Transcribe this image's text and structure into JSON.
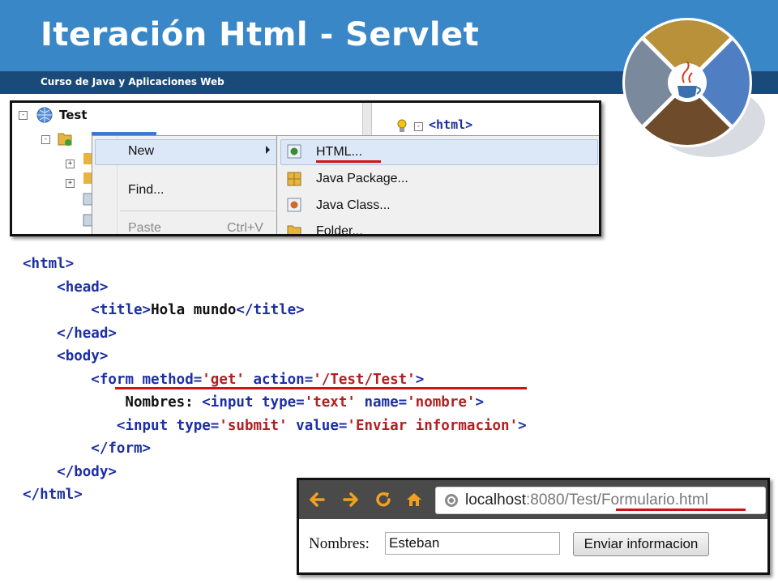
{
  "slide": {
    "title": "Iteración Html - Servlet",
    "subtitle": "Curso de Java y Aplicaciones Web"
  },
  "colors": {
    "header_blue": "#3a87c8",
    "subbar_navy": "#1a4a7a",
    "tag_blue": "#1c2fa3",
    "value_red": "#b02020",
    "underline_red": "#d01414"
  },
  "logo": {
    "icon": "java-cup-icon"
  },
  "ide": {
    "tree_root": "Test",
    "editor_tag": "<html>",
    "context_menu": {
      "items": [
        "New",
        "Find...",
        "Paste"
      ],
      "paste_shortcut": "Ctrl+V"
    },
    "new_submenu": {
      "items": [
        "HTML...",
        "Java Package...",
        "Java Class...",
        "Folder..."
      ]
    }
  },
  "code": {
    "lines": [
      [
        {
          "t": "tag",
          "v": "<html>"
        }
      ],
      [
        {
          "t": "text",
          "v": "    "
        },
        {
          "t": "tag",
          "v": "<head>"
        }
      ],
      [
        {
          "t": "text",
          "v": "        "
        },
        {
          "t": "tag",
          "v": "<title>"
        },
        {
          "t": "text",
          "v": "Hola mundo"
        },
        {
          "t": "tag",
          "v": "</title>"
        }
      ],
      [
        {
          "t": "text",
          "v": "    "
        },
        {
          "t": "tag",
          "v": "</head>"
        }
      ],
      [
        {
          "t": "text",
          "v": "    "
        },
        {
          "t": "tag",
          "v": "<body>"
        }
      ],
      [
        {
          "t": "text",
          "v": "        "
        },
        {
          "t": "tag",
          "v": "<form method="
        },
        {
          "t": "val",
          "v": "'get'"
        },
        {
          "t": "tag",
          "v": " action="
        },
        {
          "t": "val",
          "v": "'/Test/Test'"
        },
        {
          "t": "tag",
          "v": ">"
        }
      ],
      [
        {
          "t": "text",
          "v": "            Nombres: "
        },
        {
          "t": "tag",
          "v": "<input type="
        },
        {
          "t": "val",
          "v": "'text'"
        },
        {
          "t": "tag",
          "v": " name="
        },
        {
          "t": "val",
          "v": "'nombre'"
        },
        {
          "t": "tag",
          "v": ">"
        }
      ],
      [
        {
          "t": "text",
          "v": "           "
        },
        {
          "t": "tag",
          "v": "<input type="
        },
        {
          "t": "val",
          "v": "'submit'"
        },
        {
          "t": "tag",
          "v": " value="
        },
        {
          "t": "val",
          "v": "'Enviar informacion'"
        },
        {
          "t": "tag",
          "v": ">"
        }
      ],
      [
        {
          "t": "text",
          "v": "        "
        },
        {
          "t": "tag",
          "v": "</form>"
        }
      ],
      [
        {
          "t": "text",
          "v": "    "
        },
        {
          "t": "tag",
          "v": "</body>"
        }
      ],
      [
        {
          "t": "tag",
          "v": "</html>"
        }
      ]
    ]
  },
  "browser": {
    "url_host": "localhost",
    "url_rest": ":8080/Test/",
    "url_page": "Formulario.html",
    "form_label": "Nombres:",
    "input_value": "Esteban",
    "button_label": "Enviar informacion"
  }
}
